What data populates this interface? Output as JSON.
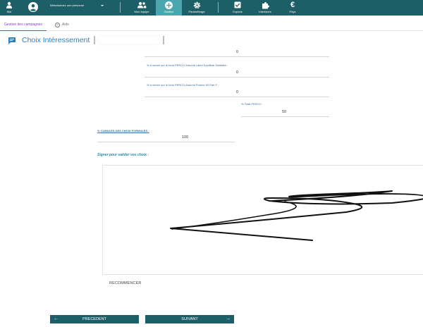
{
  "topbar": {
    "moi": "Moi",
    "person_select": "Sélectionnez une personne",
    "mon_equipe": "Mon équipe",
    "gestion": "Gestion",
    "parametrage": "Paramétrage",
    "exports": "Exports",
    "interfaces": "Interfaces",
    "pays": "Pays",
    "colors": {
      "bar": "#1d5f66",
      "active": "#4aa7b0"
    }
  },
  "tabs": {
    "active": "Gestion des campagnes",
    "help": "Aide"
  },
  "page": {
    "title": "Choix Intéressement"
  },
  "fields": {
    "f1_value": "0",
    "f2_label": "% à verser sur le fond PERCO Amundi Label Equilibre Solidaire :",
    "f2_value": "0",
    "f3_label": "% à verser sur le fond PERCO Amundi Protect 90 Part F :",
    "f3_value": "0",
    "total_label": "% Total PERCO :",
    "total_value": "50",
    "cumul_label": "% CUMULES DES CHOIX FORMULES :",
    "cumul_value": "100"
  },
  "signature": {
    "label": "Signer pour valider vos choix :",
    "restart": "RECOMMENCER"
  },
  "buttons": {
    "prev": "PRECEDENT",
    "next": "SUIVANT"
  }
}
